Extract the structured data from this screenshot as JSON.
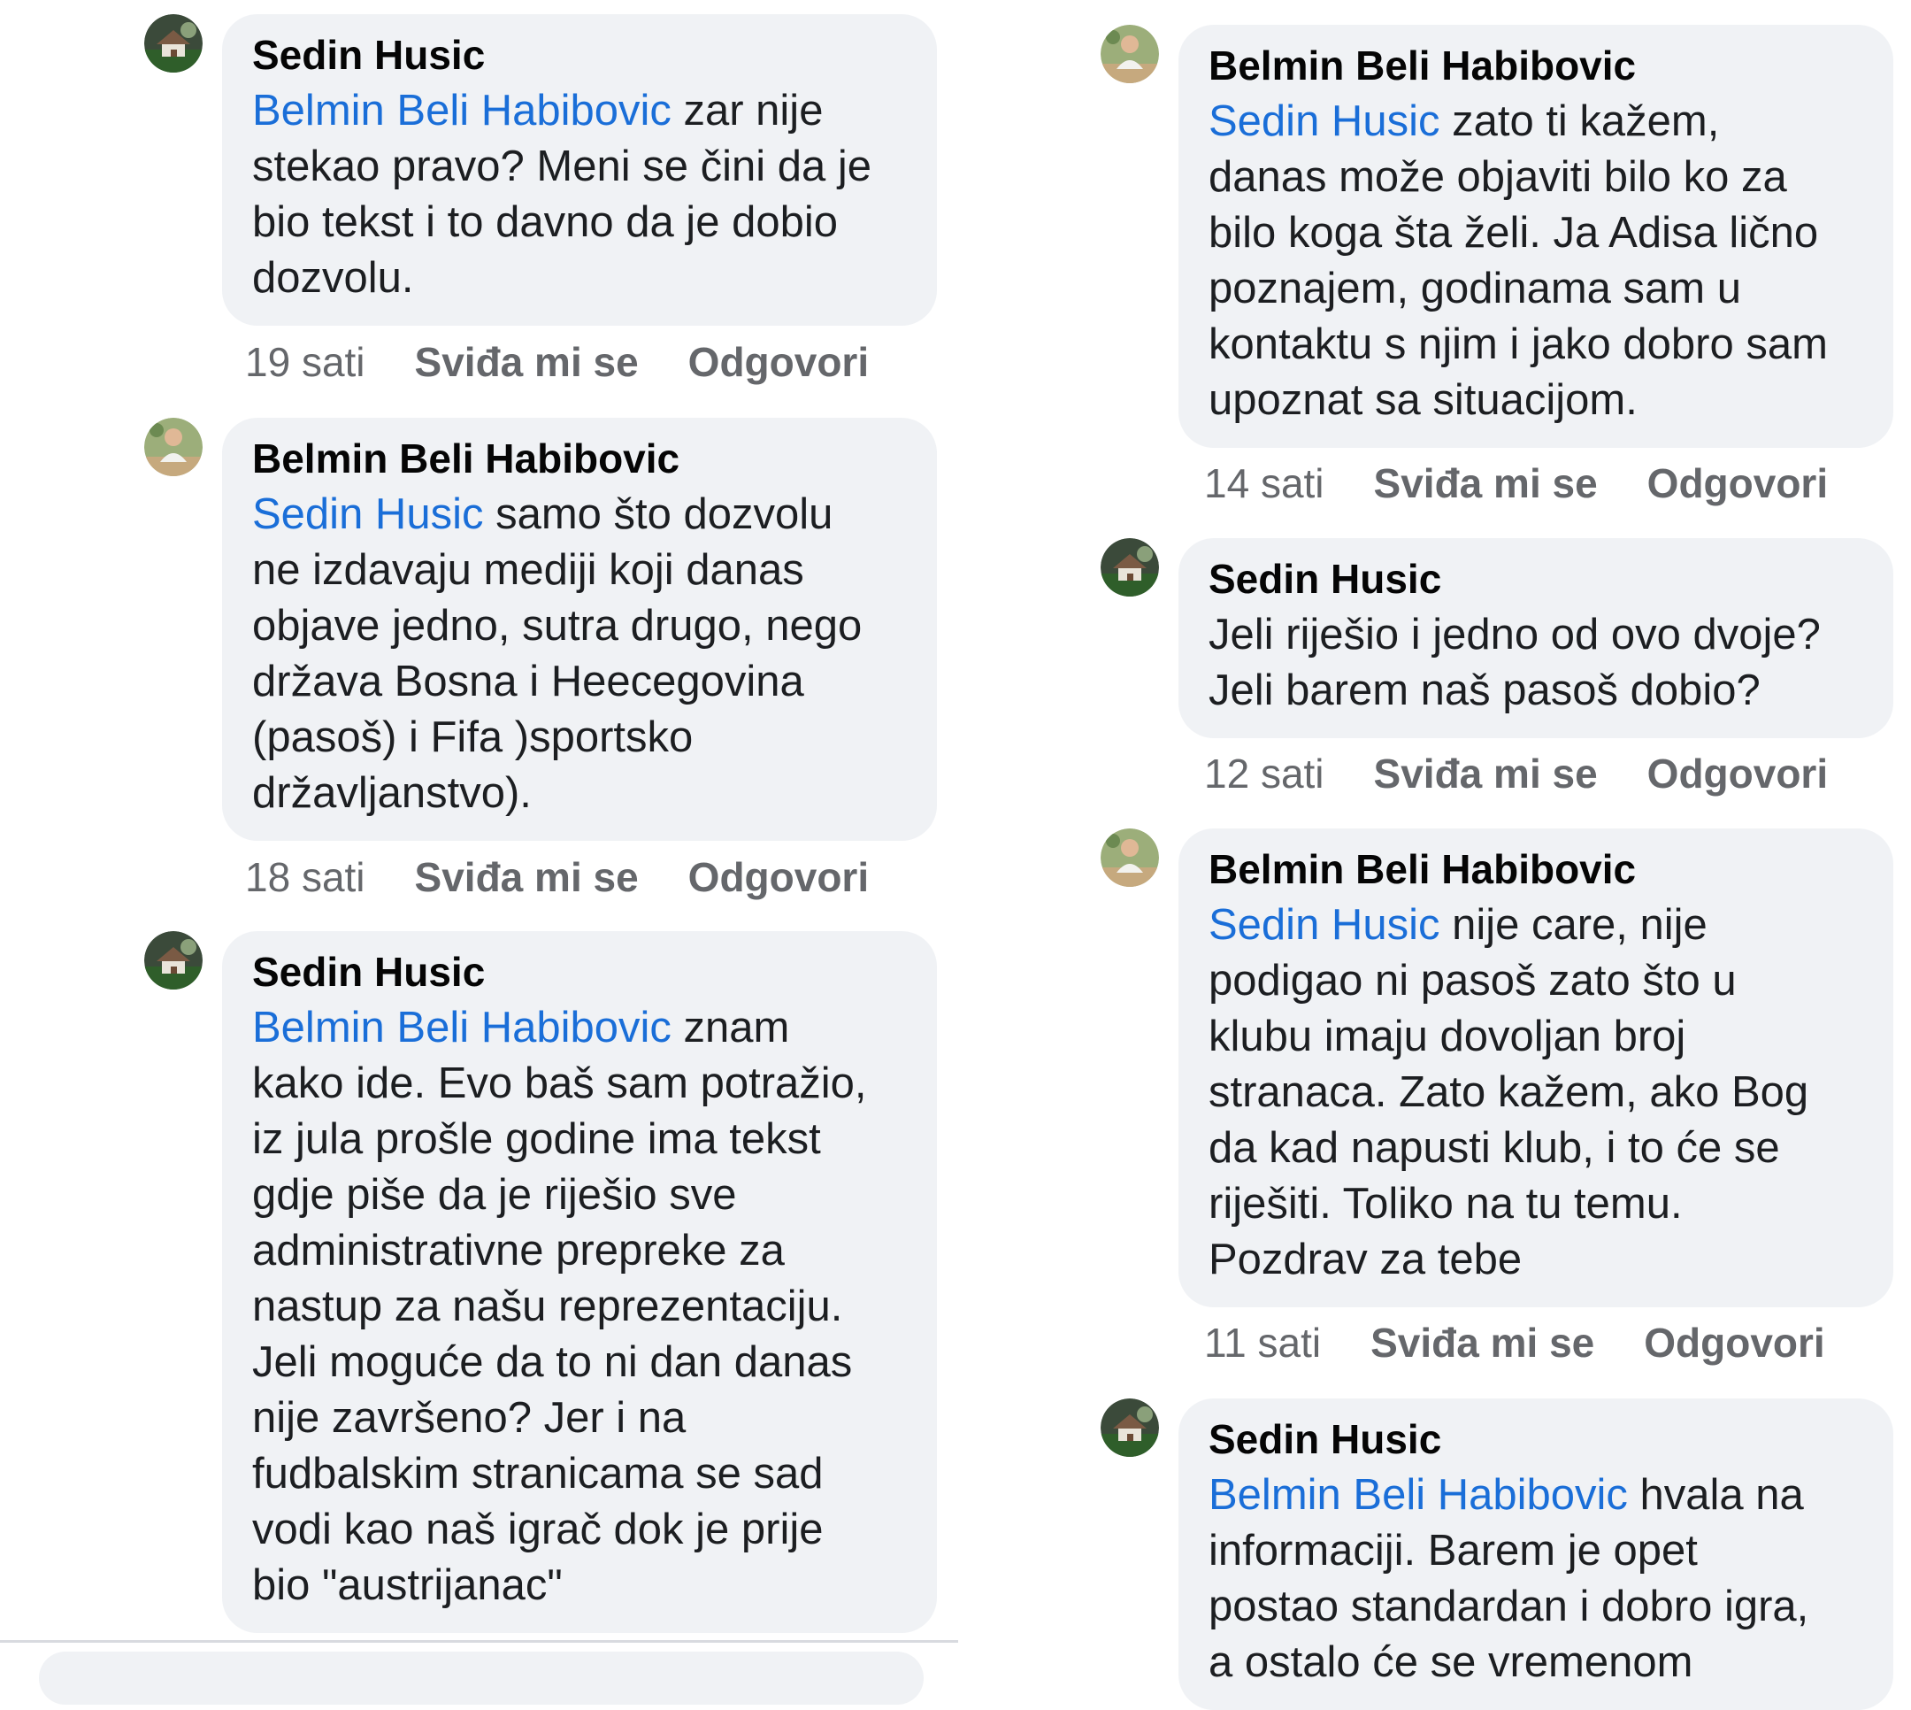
{
  "colors": {
    "bubble": "#f0f2f5",
    "mention": "#1a6ed8",
    "meta": "#65676b",
    "text": "#050505"
  },
  "comments": [
    {
      "author": "Sedin Husic",
      "avatar": "sedin-avatar-icon",
      "mention": "Belmin Beli Habibovic",
      "lines": [
        " zar nije",
        "stekao pravo? Meni se čini da je",
        "bio tekst i to davno da je dobio",
        "dozvolu."
      ],
      "time": "19 sati",
      "like": "Sviđa mi se",
      "reply": "Odgovori"
    },
    {
      "author": "Belmin Beli Habibovic",
      "avatar": "belmin-avatar-icon",
      "mention": "Sedin Husic",
      "lines": [
        " samo što dozvolu",
        "ne izdavaju mediji koji danas",
        "objave jedno, sutra drugo, nego",
        "država Bosna i Heecegovina",
        "(pasoš) i Fifa )sportsko",
        "državljanstvo)."
      ],
      "time": "18 sati",
      "like": "Sviđa mi se",
      "reply": "Odgovori"
    },
    {
      "author": "Sedin Husic",
      "avatar": "sedin-avatar-icon",
      "mention": "Belmin Beli Habibovic",
      "lines": [
        " znam",
        "kako ide. Evo baš sam potražio,",
        "iz jula prošle godine ima tekst",
        "gdje piše da je riješio sve",
        "administrativne prepreke za",
        "nastup za našu reprezentaciju.",
        "Jeli moguće da to ni dan danas",
        "nije završeno? Jer i na",
        "fudbalskim stranicama se sad",
        "vodi kao naš igrač dok je prije",
        "bio \"austrijanac\""
      ]
    },
    {
      "author": "Belmin Beli Habibovic",
      "avatar": "belmin-avatar-icon",
      "mention": "Sedin Husic",
      "lines": [
        " zato ti kažem,",
        "danas može objaviti bilo ko za",
        "bilo koga šta želi. Ja Adisa lično",
        "poznajem, godinama sam u",
        "kontaktu s njim i jako dobro sam",
        "upoznat sa situacijom."
      ],
      "time": "14 sati",
      "like": "Sviđa mi se",
      "reply": "Odgovori"
    },
    {
      "author": "Sedin Husic",
      "avatar": "sedin-avatar-icon",
      "mention": "",
      "lines": [
        "Jeli riješio i jedno od ovo dvoje?",
        "Jeli barem naš pasoš dobio?"
      ],
      "time": "12 sati",
      "like": "Sviđa mi se",
      "reply": "Odgovori"
    },
    {
      "author": "Belmin Beli Habibovic",
      "avatar": "belmin-avatar-icon",
      "mention": "Sedin Husic",
      "lines": [
        " nije care, nije",
        "podigao ni pasoš zato što u",
        "klubu imaju dovoljan broj",
        "stranaca. Zato kažem, ako Bog",
        "da kad napusti klub, i to će se",
        "riješiti. Toliko na tu temu.",
        "Pozdrav za tebe"
      ],
      "time": "11 sati",
      "like": "Sviđa mi se",
      "reply": "Odgovori"
    },
    {
      "author": "Sedin Husic",
      "avatar": "sedin-avatar-icon",
      "mention": "Belmin Beli Habibovic",
      "lines": [
        " hvala na",
        "informaciji. Barem je opet",
        "postao standardan i dobro igra,",
        "a ostalo će se vremenom"
      ]
    }
  ]
}
